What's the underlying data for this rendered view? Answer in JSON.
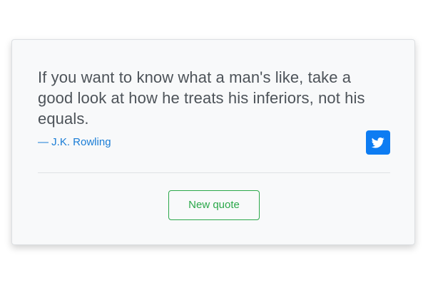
{
  "quote": {
    "text": "If you want to know what a man's like, take a good look at how he treats his inferiors, not his equals.",
    "author": "— J.K. Rowling"
  },
  "actions": {
    "tweet_icon": "twitter-icon",
    "new_quote_label": "New quote"
  },
  "colors": {
    "card_background": "#f8f9fa",
    "quote_text": "#4d5359",
    "author_link": "#1a7dd6",
    "tweet_button": "#0d7cf2",
    "new_quote_button": "#2ba84a"
  }
}
